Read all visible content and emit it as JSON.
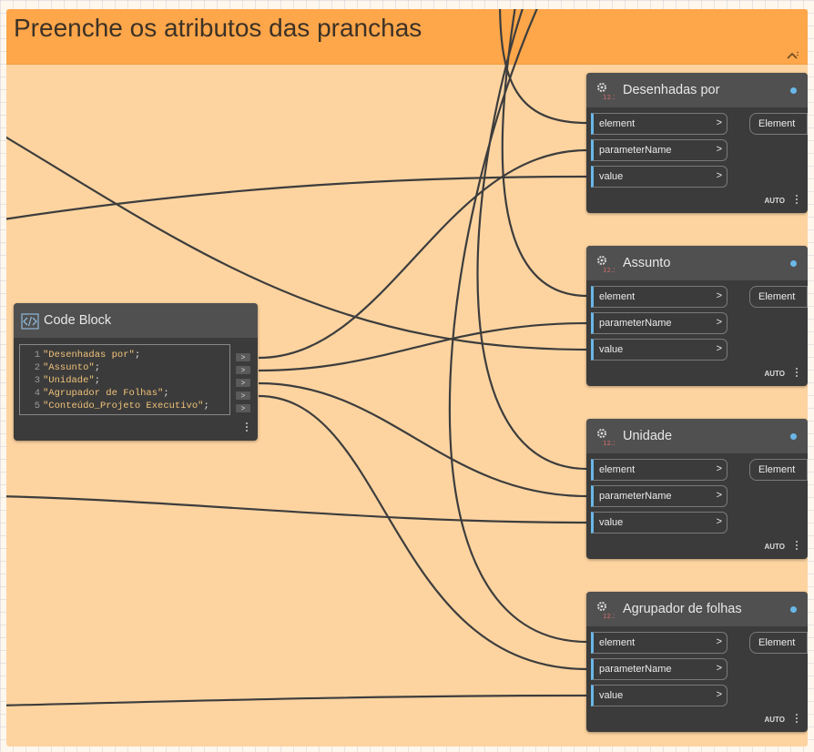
{
  "group": {
    "title": "Preenche os atributos das pranchas",
    "color": "#fea64a"
  },
  "code_block": {
    "title": "Code Block",
    "lines": [
      {
        "no": "1",
        "text": "\"Desenhadas por\""
      },
      {
        "no": "2",
        "text": "\"Assunto\""
      },
      {
        "no": "3",
        "text": "\"Unidade\""
      },
      {
        "no": "4",
        "text": "\"Agrupador de Folhas\""
      },
      {
        "no": "5",
        "text": "\"Conteúdo_Projeto Executivo\""
      }
    ],
    "line_end": ";",
    "output_glyph": ">"
  },
  "set_nodes": [
    {
      "title": "Desenhadas por",
      "inputs": [
        "element",
        "parameterName",
        "value"
      ],
      "output": "Element",
      "lacing": "AUTO"
    },
    {
      "title": "Assunto",
      "inputs": [
        "element",
        "parameterName",
        "value"
      ],
      "output": "Element",
      "lacing": "AUTO"
    },
    {
      "title": "Unidade",
      "inputs": [
        "element",
        "parameterName",
        "value"
      ],
      "output": "Element",
      "lacing": "AUTO"
    },
    {
      "title": "Agrupador de folhas",
      "inputs": [
        "element",
        "parameterName",
        "value"
      ],
      "output": "Element",
      "lacing": "AUTO"
    }
  ],
  "port_arrow": ">",
  "colors": {
    "node_body": "#3b3b3b",
    "node_header": "#505050",
    "port_accent": "#6ab7e8",
    "code_string": "#f0c37a",
    "wire": "#3d3d3d"
  }
}
